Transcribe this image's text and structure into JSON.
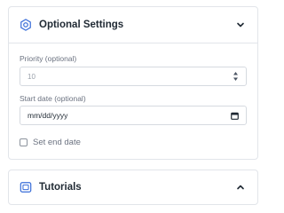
{
  "settings_panel": {
    "title": "Optional Settings",
    "icon": "gear-icon",
    "expanded": true,
    "priority": {
      "label": "Priority (optional)",
      "placeholder": "10"
    },
    "start_date": {
      "label": "Start date (optional)",
      "value": "mm/dd/yyyy"
    },
    "end_date_checkbox": {
      "label": "Set end date",
      "checked": false
    }
  },
  "tutorials_panel": {
    "title": "Tutorials",
    "icon": "tv-icon",
    "expanded": false
  },
  "colors": {
    "accent": "#3b6fd9",
    "text": "#1f2933",
    "muted": "#6b7280",
    "border": "#e2e5ea"
  }
}
